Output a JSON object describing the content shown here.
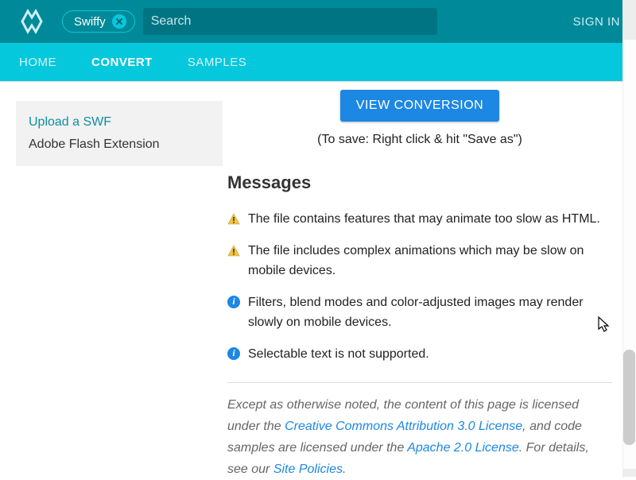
{
  "header": {
    "chip_label": "Swiffy",
    "search_placeholder": "Search",
    "signin": "SIGN IN"
  },
  "nav": {
    "home": "HOME",
    "convert": "CONVERT",
    "samples": "SAMPLES"
  },
  "sidebar": {
    "upload": "Upload a SWF",
    "extension": "Adobe Flash Extension"
  },
  "main": {
    "view_button": "VIEW CONVERSION",
    "save_hint": "(To save: Right click & hit \"Save as\")",
    "messages_title": "Messages",
    "messages": [
      {
        "type": "warn",
        "text": "The file contains features that may animate too slow as HTML."
      },
      {
        "type": "warn",
        "text": "The file includes complex animations which may be slow on mobile devices."
      },
      {
        "type": "info",
        "text": "Filters, blend modes and color-adjusted images may render slowly on mobile devices."
      },
      {
        "type": "info",
        "text": "Selectable text is not supported."
      }
    ]
  },
  "footer": {
    "t1": "Except as otherwise noted, the content of this page is licensed under the ",
    "l1": "Creative Commons Attribution 3.0 License",
    "t2": ", and code samples are licensed under the ",
    "l2": "Apache 2.0 License",
    "t3": ". For details, see our ",
    "l3": "Site Policies",
    "t4": "."
  }
}
